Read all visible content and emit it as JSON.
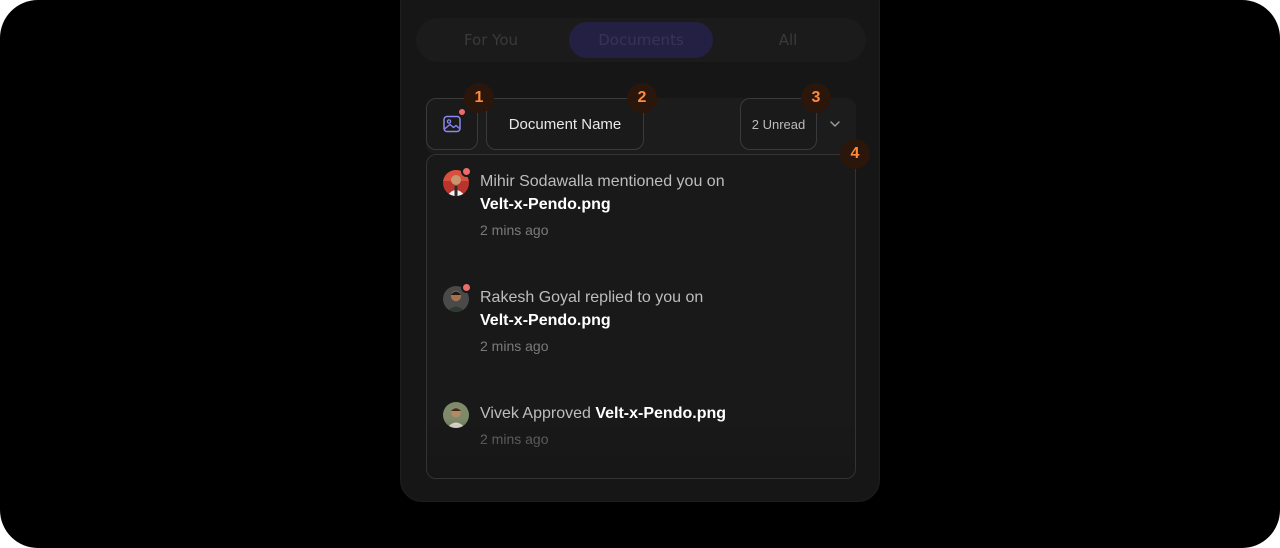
{
  "tabs": [
    {
      "label": "For You"
    },
    {
      "label": "Documents"
    },
    {
      "label": "All"
    }
  ],
  "filters": {
    "image_icon": "image-icon",
    "document_name_label": "Document Name",
    "unread_label": "2 Unread",
    "chevron_icon": "chevron-down-icon"
  },
  "markers": [
    "1",
    "2",
    "3",
    "4"
  ],
  "notifications": [
    {
      "actor": "Mihir Sodawalla",
      "action": " mentioned you on",
      "file": "Velt-x-Pendo.png",
      "time": "2 mins ago",
      "unread": true
    },
    {
      "actor": "Rakesh Goyal",
      "action": " replied to you on",
      "file": "Velt-x-Pendo.png",
      "time": "2 mins ago",
      "unread": true
    },
    {
      "actor": "Vivek",
      "action": " Approved ",
      "file": "Velt-x-Pendo.png",
      "time": "2 mins ago",
      "unread": false
    }
  ],
  "colors": {
    "background": "#000000",
    "panel": "#161616",
    "active_tab": "#232044",
    "unread_dot": "#ef6b6b",
    "marker_text": "#ff8a3d",
    "marker_bg": "#2a160b"
  }
}
